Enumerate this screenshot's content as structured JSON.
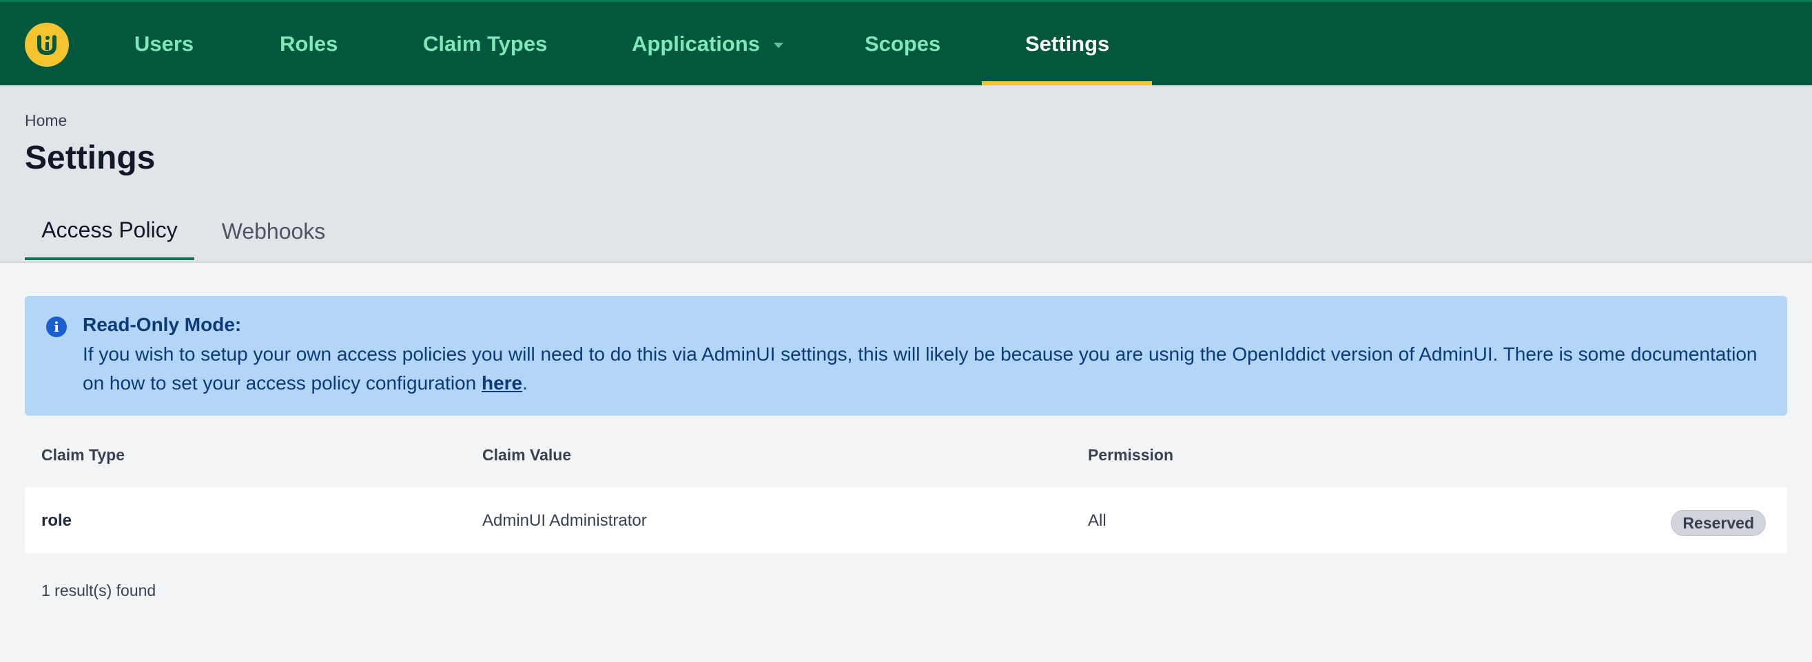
{
  "nav": {
    "items": [
      {
        "label": "Users"
      },
      {
        "label": "Roles"
      },
      {
        "label": "Claim Types"
      },
      {
        "label": "Applications"
      },
      {
        "label": "Scopes"
      },
      {
        "label": "Settings"
      }
    ],
    "active": "Settings"
  },
  "header": {
    "breadcrumb": "Home",
    "title": "Settings",
    "tabs": [
      {
        "label": "Access Policy"
      },
      {
        "label": "Webhooks"
      }
    ]
  },
  "alert": {
    "icon": "info-icon",
    "title": "Read-Only Mode:",
    "body": "If you wish to setup your own access policies you will need to do this via AdminUI settings, this will likely be because you are usnig the OpenIddict version of AdminUI. There is some documentation on how to set your access policy configuration ",
    "link_text": "here",
    "trailing": "."
  },
  "table": {
    "columns": [
      "Claim Type",
      "Claim Value",
      "Permission"
    ],
    "rows": [
      {
        "claim_type": "role",
        "claim_value": "AdminUI Administrator",
        "permission": "All",
        "badge": "Reserved"
      }
    ]
  },
  "result_count": "1 result(s) found",
  "colors": {
    "nav_bg": "#02573d",
    "nav_link": "#7ee8b8",
    "nav_active_underline": "#f6c334",
    "logo": "#f4c430",
    "alert_bg": "#b3d6f6",
    "tab_active_underline": "#0a7a55"
  }
}
